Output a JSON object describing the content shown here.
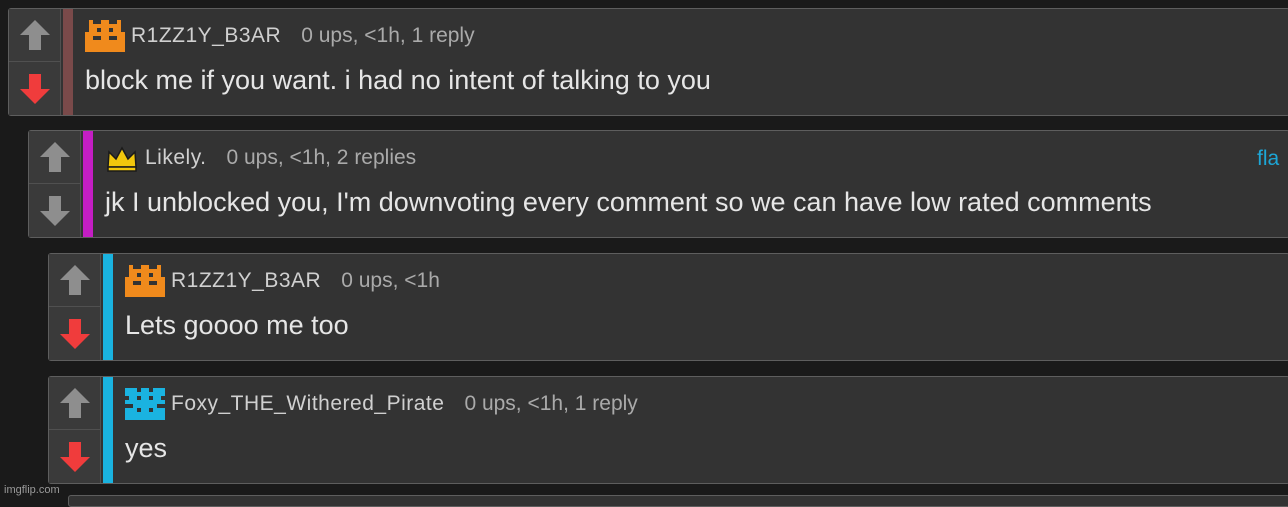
{
  "comments": [
    {
      "username": "R1ZZ1Y_B3AR",
      "meta": "0 ups, <1h, 1 reply",
      "text": "block me if you want. i had no intent of talking to you",
      "bar_color": "#7a4a4a",
      "avatar": "orange-pixel-avatar-icon",
      "down_color": "#f03c3c"
    },
    {
      "username": "Likely.",
      "meta": "0 ups, <1h, 2 replies",
      "text": "jk I unblocked you, I'm downvoting every comment so we can have low rated comments",
      "flag": "fla",
      "bar_color": "#c41ec4",
      "avatar": "crown-icon",
      "down_color": "#8e8e8e"
    },
    {
      "username": "R1ZZ1Y_B3AR",
      "meta": "0 ups, <1h",
      "text": "Lets goooo me too",
      "bar_color": "#1ab3e0",
      "avatar": "orange-pixel-avatar-icon",
      "down_color": "#f03c3c"
    },
    {
      "username": "Foxy_THE_Withered_Pirate",
      "meta": "0 ups, <1h, 1 reply",
      "text": "yes",
      "bar_color": "#1ab3e0",
      "avatar": "blue-pixel-avatar-icon",
      "down_color": "#f03c3c"
    }
  ],
  "watermark": "imgflip.com"
}
